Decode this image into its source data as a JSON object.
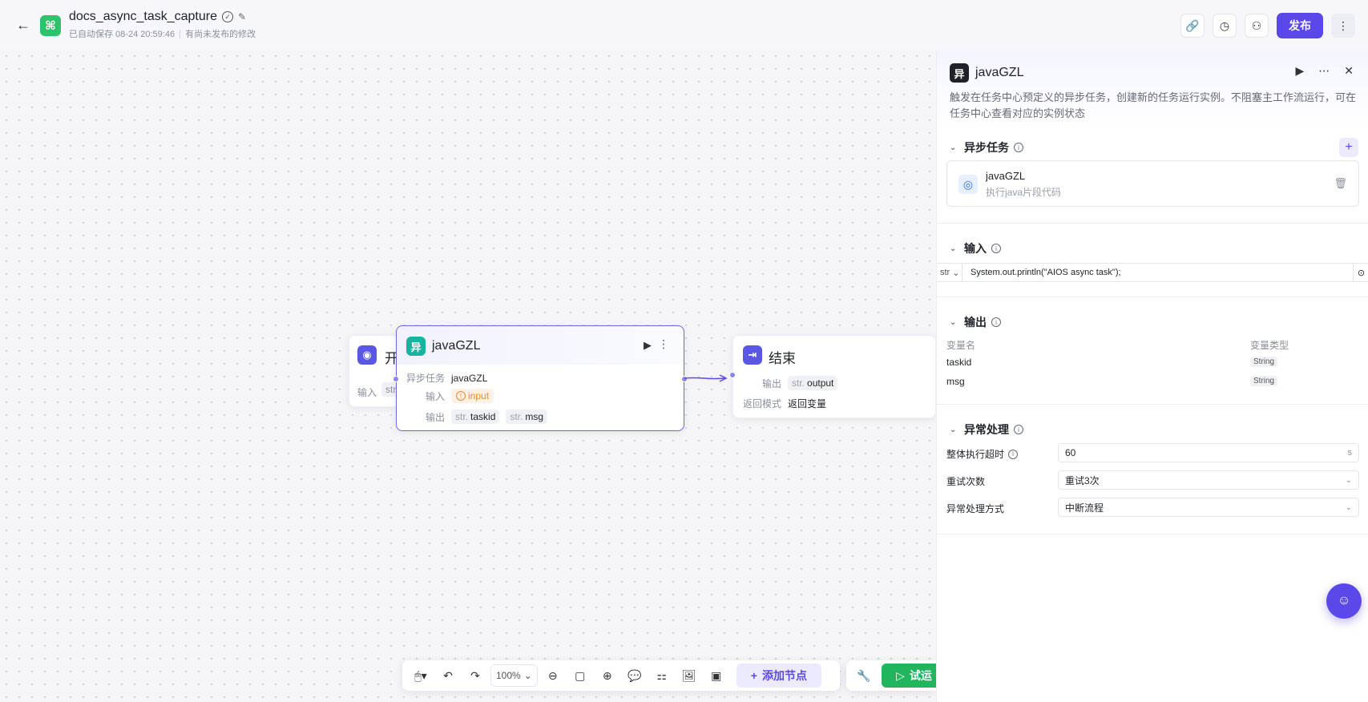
{
  "header": {
    "title": "docs_async_task_capture",
    "autosave": "已自动保存 08-24 20:59:46",
    "unpublished": "有尚未发布的修改",
    "publish_label": "发布"
  },
  "canvas": {
    "start_node": {
      "title": "开",
      "input_label": "输入",
      "input_tag": "str"
    },
    "main_node": {
      "icon_text": "异",
      "title": "javaGZL",
      "async_task_label": "异步任务",
      "async_task_value": "javaGZL",
      "input_label": "输入",
      "input_chip": "input",
      "output_label": "输出",
      "outputs": [
        {
          "type": "str.",
          "name": "taskid"
        },
        {
          "type": "str.",
          "name": "msg"
        }
      ]
    },
    "end_node": {
      "title": "结束",
      "output_label": "输出",
      "output_type": "str.",
      "output_name": "output",
      "return_mode_label": "返回模式",
      "return_mode_value": "返回变量"
    }
  },
  "toolbar": {
    "zoom": "100%",
    "add_node_label": "添加节点",
    "run_label": "试运"
  },
  "panel": {
    "icon_text": "异",
    "title": "javaGZL",
    "description": "触发在任务中心预定义的异步任务，创建新的任务运行实例。不阻塞主工作流运行，可在任务中心查看对应的实例状态",
    "async_section": {
      "title": "异步任务",
      "card_name": "javaGZL",
      "card_sub": "执行java片段代码"
    },
    "input_section": {
      "title": "输入",
      "type": "str",
      "value": "System.out.println(\"AIOS async task\");"
    },
    "output_section": {
      "title": "输出",
      "col_name": "变量名",
      "col_type": "变量类型",
      "rows": [
        {
          "name": "taskid",
          "type": "String"
        },
        {
          "name": "msg",
          "type": "String"
        }
      ]
    },
    "error_section": {
      "title": "异常处理",
      "timeout_label": "整体执行超时",
      "timeout_value": "60",
      "timeout_unit": "s",
      "retry_label": "重试次数",
      "retry_value": "重试3次",
      "mode_label": "异常处理方式",
      "mode_value": "中断流程"
    }
  },
  "colors": {
    "accent": "#5b48e8",
    "run": "#21b55e",
    "logo": "#2ec26a"
  }
}
